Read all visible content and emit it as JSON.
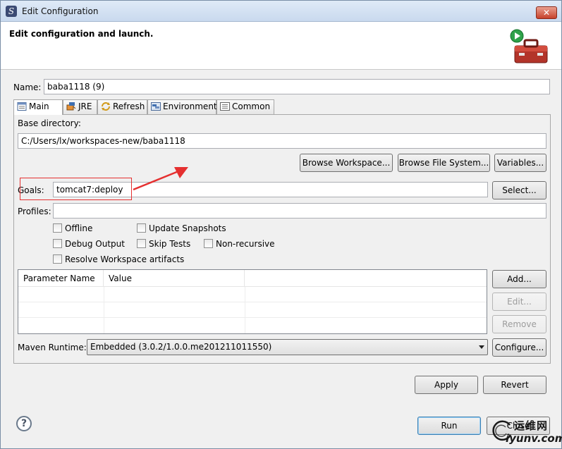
{
  "window": {
    "title": "Edit Configuration",
    "close_label": "✕"
  },
  "banner": {
    "title": "Edit configuration and launch."
  },
  "name_field": {
    "label": "Name:",
    "value": "baba1118 (9)"
  },
  "tabs": [
    {
      "label": "Main",
      "icon": "main-tab-icon",
      "active": true
    },
    {
      "label": "JRE",
      "icon": "jre-tab-icon",
      "active": false
    },
    {
      "label": "Refresh",
      "icon": "refresh-tab-icon",
      "active": false
    },
    {
      "label": "Environment",
      "icon": "environment-tab-icon",
      "active": false
    },
    {
      "label": "Common",
      "icon": "common-tab-icon",
      "active": false
    }
  ],
  "main": {
    "base_dir_label": "Base directory:",
    "base_dir_value": "C:/Users/lx/workspaces-new/baba1118",
    "browse_workspace": "Browse Workspace...",
    "browse_file_system": "Browse File System...",
    "variables": "Variables...",
    "goals_label": "Goals:",
    "goals_value": "tomcat7:deploy",
    "select": "Select...",
    "profiles_label": "Profiles:",
    "profiles_value": "",
    "checkboxes": {
      "offline": "Offline",
      "update_snapshots": "Update Snapshots",
      "debug_output": "Debug Output",
      "skip_tests": "Skip Tests",
      "non_recursive": "Non-recursive",
      "resolve_workspace": "Resolve Workspace artifacts"
    },
    "table": {
      "col_name": "Parameter Name",
      "col_value": "Value"
    },
    "add": "Add...",
    "edit": "Edit...",
    "remove": "Remove",
    "runtime_label": "Maven Runtime:",
    "runtime_value": "Embedded (3.0.2/1.0.0.me201211011550)",
    "configure": "Configure..."
  },
  "footer": {
    "apply": "Apply",
    "revert": "Revert",
    "run": "Run",
    "close": "Close"
  },
  "watermark": {
    "line1": "运维网",
    "line2": "iyunv.com"
  },
  "colors": {
    "annotation": "#e53030",
    "default_button_border": "#3c7fb1"
  }
}
